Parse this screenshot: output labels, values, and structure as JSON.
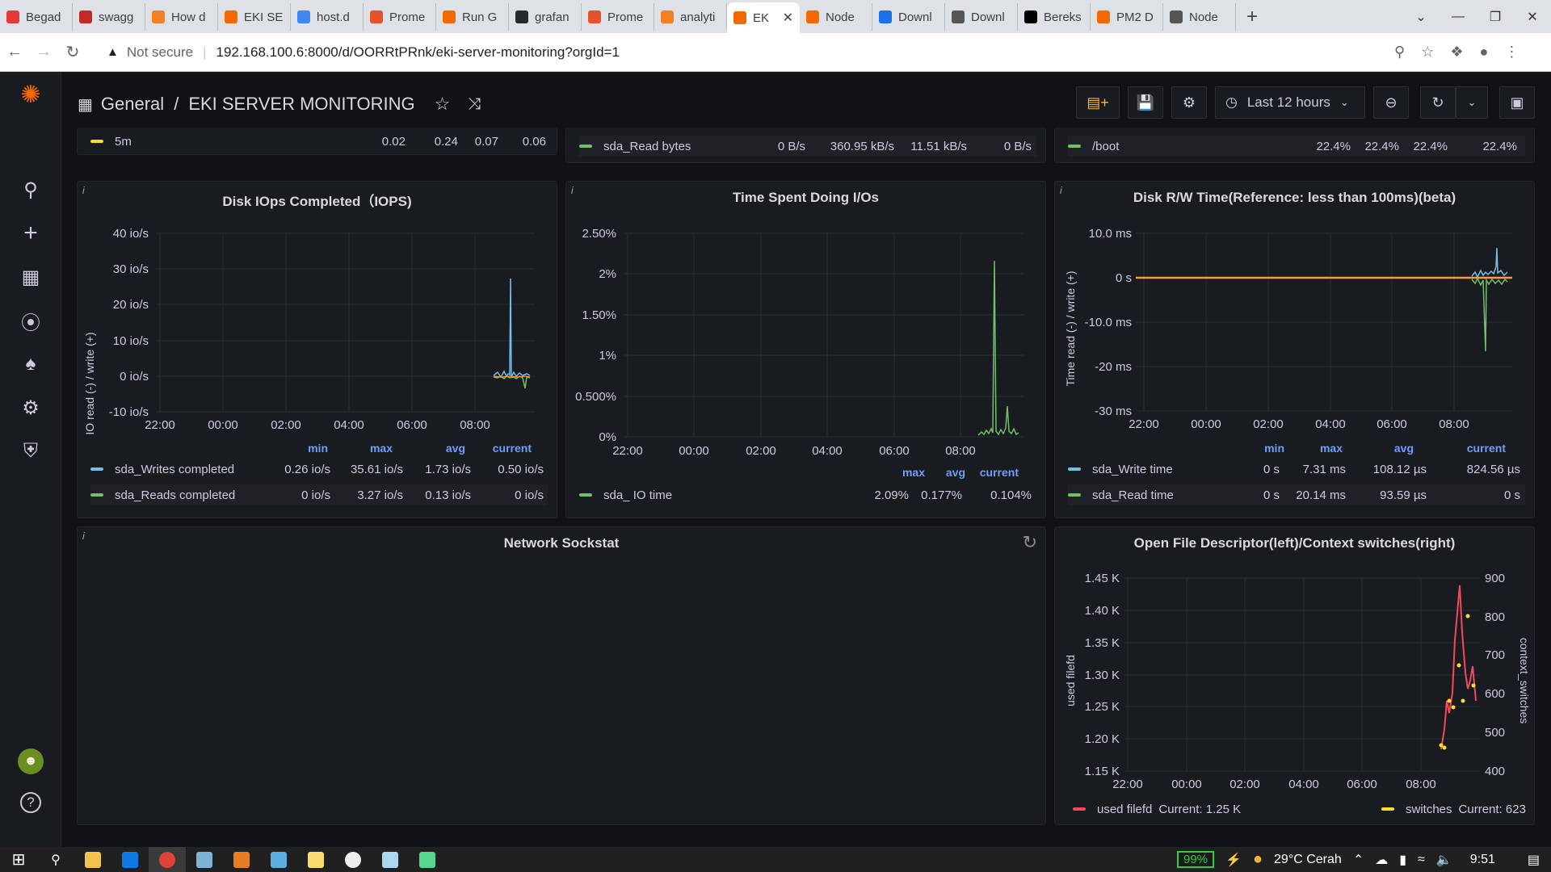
{
  "browser": {
    "tabs": [
      {
        "label": "Begad",
        "color": "#e53935"
      },
      {
        "label": "swagg",
        "color": "#c62828"
      },
      {
        "label": "How d",
        "color": "#f48024"
      },
      {
        "label": "EKI SE",
        "color": "#f46800"
      },
      {
        "label": "host.d",
        "color": "#4285f4"
      },
      {
        "label": "Prome",
        "color": "#e6522c"
      },
      {
        "label": "Run G",
        "color": "#f46800"
      },
      {
        "label": "grafan",
        "color": "#24292e"
      },
      {
        "label": "Prome",
        "color": "#e6522c"
      },
      {
        "label": "analyti",
        "color": "#f48024"
      },
      {
        "label": "EK",
        "color": "#f46800",
        "active": true
      },
      {
        "label": "Node",
        "color": "#f46800"
      },
      {
        "label": "Downl",
        "color": "#1a73e8"
      },
      {
        "label": "Downl",
        "color": "#555555"
      },
      {
        "label": "Bereks",
        "color": "#000000"
      },
      {
        "label": "PM2 D",
        "color": "#f46800"
      },
      {
        "label": "Node",
        "color": "#555555"
      }
    ],
    "not_secure": "Not secure",
    "url": "192.168.100.6:8000/d/OORRtPRnk/eki-server-monitoring?orgId=1"
  },
  "dashboard": {
    "folder": "General",
    "separator": "/",
    "title": "EKI SERVER MONITORING",
    "time_range": "Last 12 hours"
  },
  "top_strip": {
    "load": {
      "label": "5m",
      "values": [
        "0.02",
        "0.24",
        "0.07",
        "0.06"
      ]
    },
    "disk": {
      "label": "sda_Read bytes",
      "values": [
        "0 B/s",
        "360.95 kB/s",
        "11.51 kB/s",
        "0 B/s"
      ]
    },
    "fs": {
      "label": "/boot",
      "values": [
        "22.4%",
        "22.4%",
        "22.4%",
        "22.4%"
      ]
    }
  },
  "iops": {
    "title": "Disk IOps Completed（IOPS)",
    "ylabel": "IO read (-) / write (+)",
    "yticks": [
      "40 io/s",
      "30 io/s",
      "20 io/s",
      "10 io/s",
      "0 io/s",
      "-10 io/s"
    ],
    "xticks": [
      "22:00",
      "00:00",
      "02:00",
      "04:00",
      "06:00",
      "08:00"
    ],
    "headers": [
      "min",
      "max",
      "avg",
      "current"
    ],
    "rows": [
      {
        "name": "sda_Writes completed",
        "color": "#73bfe8",
        "values": [
          "0.26 io/s",
          "35.61 io/s",
          "1.73 io/s",
          "0.50 io/s"
        ]
      },
      {
        "name": "sda_Reads completed",
        "color": "#73bf69",
        "values": [
          "0 io/s",
          "3.27 io/s",
          "0.13 io/s",
          "0 io/s"
        ]
      }
    ]
  },
  "iotime": {
    "title": "Time Spent Doing I/Os",
    "yticks": [
      "2.50%",
      "2%",
      "1.50%",
      "1%",
      "0.500%",
      "0%"
    ],
    "xticks": [
      "22:00",
      "00:00",
      "02:00",
      "04:00",
      "06:00",
      "08:00"
    ],
    "headers": [
      "max",
      "avg",
      "current"
    ],
    "rows": [
      {
        "name": "sda_ IO time",
        "color": "#73bf69",
        "values": [
          "2.09%",
          "0.177%",
          "0.104%"
        ]
      }
    ]
  },
  "rwtime": {
    "title": "Disk R/W Time(Reference: less than 100ms)(beta)",
    "ylabel": "Time read (-) / write (+)",
    "yticks": [
      "10.0 ms",
      "0 s",
      "-10.0 ms",
      "-20 ms",
      "-30 ms"
    ],
    "xticks": [
      "22:00",
      "00:00",
      "02:00",
      "04:00",
      "06:00",
      "08:00"
    ],
    "headers": [
      "min",
      "max",
      "avg",
      "current"
    ],
    "rows": [
      {
        "name": "sda_Write time",
        "color": "#73bfe8",
        "values": [
          "0 s",
          "7.31 ms",
          "108.12 µs",
          "824.56 µs"
        ]
      },
      {
        "name": "sda_Read time",
        "color": "#73bf69",
        "values": [
          "0 s",
          "20.14 ms",
          "93.59 µs",
          "0 s"
        ]
      }
    ]
  },
  "sockstat": {
    "title": "Network Sockstat"
  },
  "filefd": {
    "title": "Open File Descriptor(left)/Context switches(right)",
    "ylabel_left": "used filefd",
    "ylabel_right": "context_switches",
    "yticks_left": [
      "1.45 K",
      "1.40 K",
      "1.35 K",
      "1.30 K",
      "1.25 K",
      "1.20 K",
      "1.15 K"
    ],
    "yticks_right": [
      "900",
      "800",
      "700",
      "600",
      "500",
      "400"
    ],
    "xticks": [
      "22:00",
      "00:00",
      "02:00",
      "04:00",
      "06:00",
      "08:00"
    ],
    "legend": [
      {
        "name": "used filefd",
        "current": "Current: 1.25 K",
        "color": "#f2495c"
      },
      {
        "name": "switches",
        "current": "Current: 623",
        "color": "#fade2a"
      }
    ]
  },
  "taskbar": {
    "battery": "99%",
    "weather": "29°C  Cerah",
    "time": "9:51"
  }
}
